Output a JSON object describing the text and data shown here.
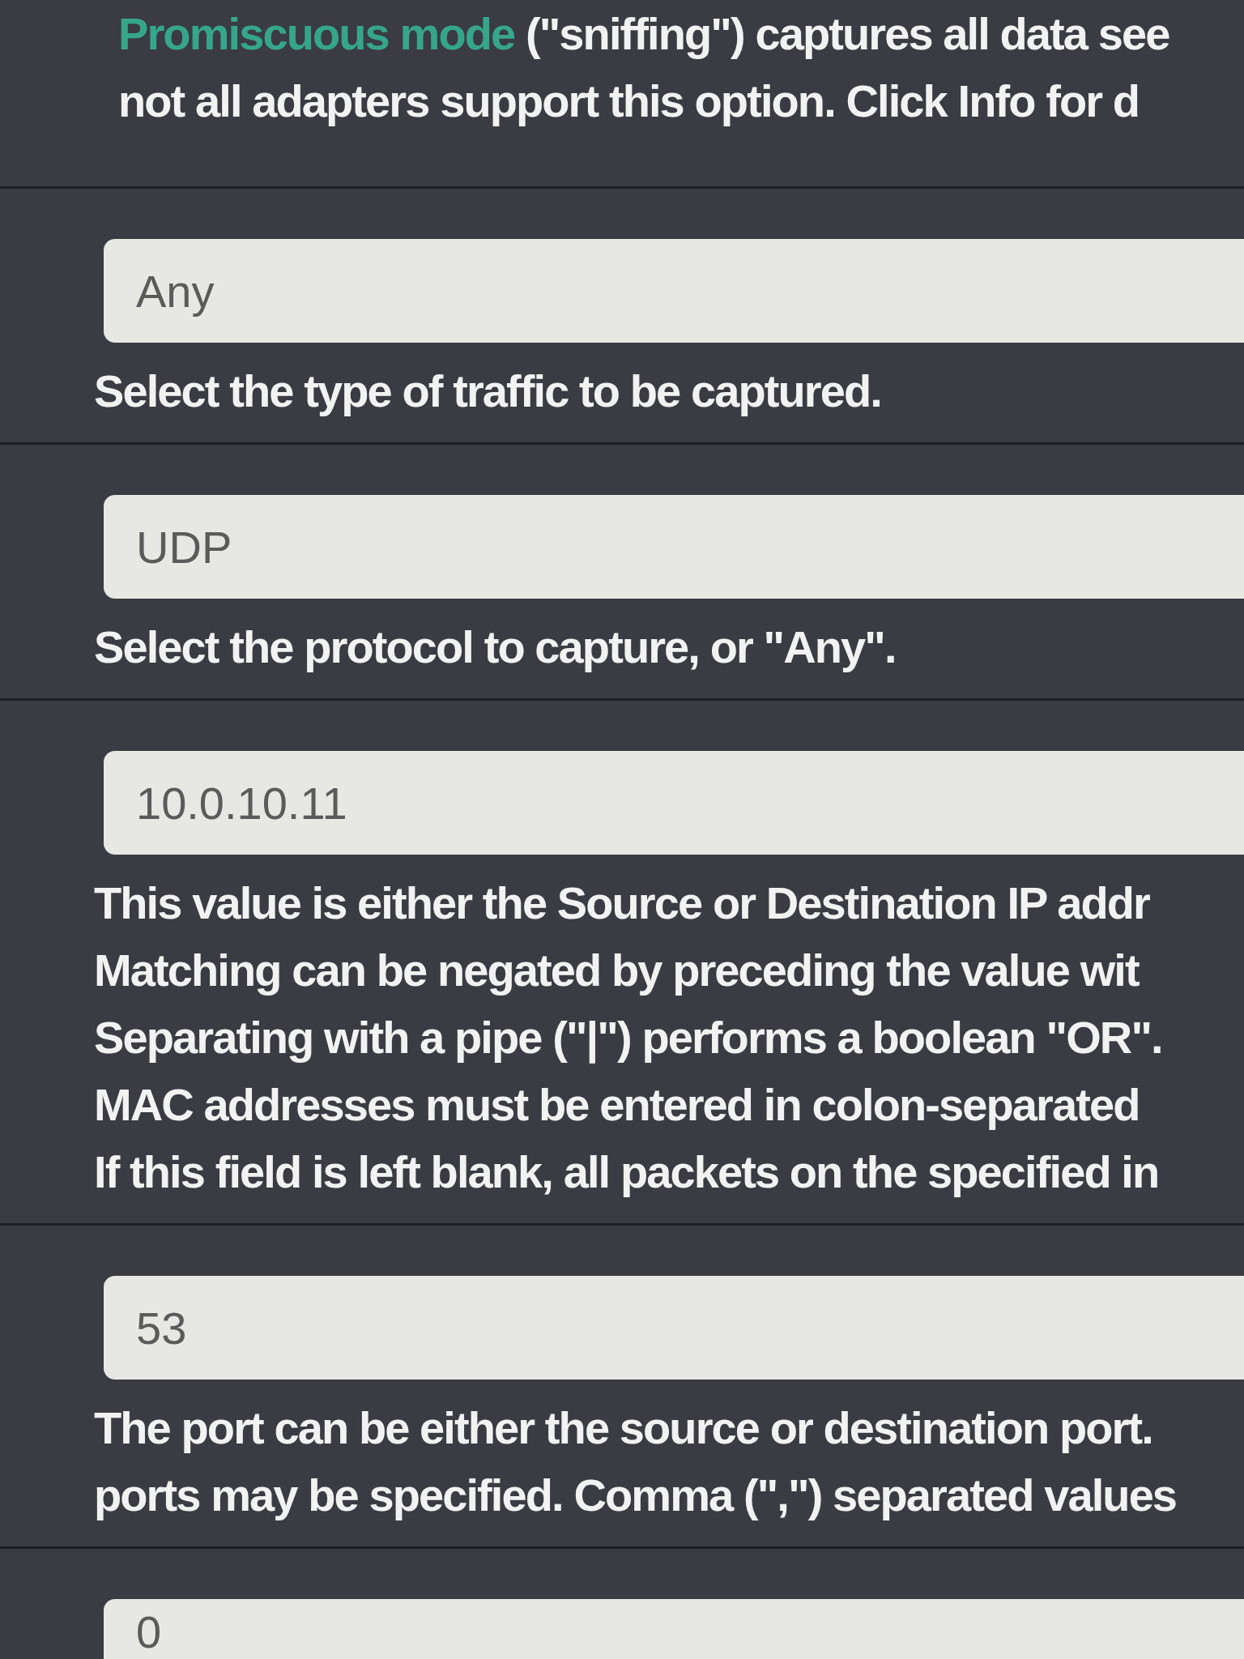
{
  "sections": [
    {
      "help": {
        "link": "Promiscuous mode",
        "lines": [
          "(\"sniffing\") captures all data see",
          "not all adapters support this option. Click Info for d"
        ]
      }
    },
    {
      "field": {
        "value": "Any"
      },
      "help": {
        "lines": [
          "Select the type of traffic to be captured."
        ]
      }
    },
    {
      "field": {
        "value": "UDP"
      },
      "help": {
        "lines": [
          "Select the protocol to capture, or \"Any\"."
        ]
      }
    },
    {
      "field": {
        "value": "10.0.10.11"
      },
      "help": {
        "lines": [
          "This value is either the Source or Destination IP addr",
          "Matching can be negated by preceding the value wit",
          "Separating with a pipe (\"|\") performs a boolean \"OR\".",
          "MAC addresses must be entered in colon-separated",
          "If this field is left blank, all packets on the specified in"
        ]
      }
    },
    {
      "field": {
        "value": "53"
      },
      "help": {
        "lines": [
          "The port can be either the source or destination port.",
          "ports may be specified. Comma (\",\") separated values"
        ]
      }
    },
    {
      "field": {
        "value": "0"
      }
    }
  ]
}
